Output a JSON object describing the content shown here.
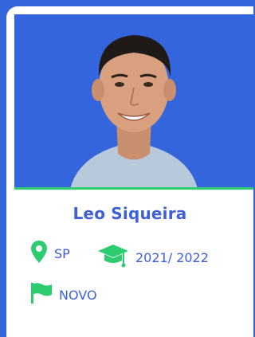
{
  "profile": {
    "name": "Leo Siqueira",
    "state": "SP",
    "year": "2021/ 2022",
    "status": "NOVO"
  },
  "icons": {
    "location": "map-pin-icon",
    "education": "graduation-cap-icon",
    "status": "flag-icon"
  },
  "colors": {
    "background": "#3366dd",
    "photo_bg": "#3465dc",
    "text": "#3d5fd8",
    "accent": "#2ecc71"
  }
}
